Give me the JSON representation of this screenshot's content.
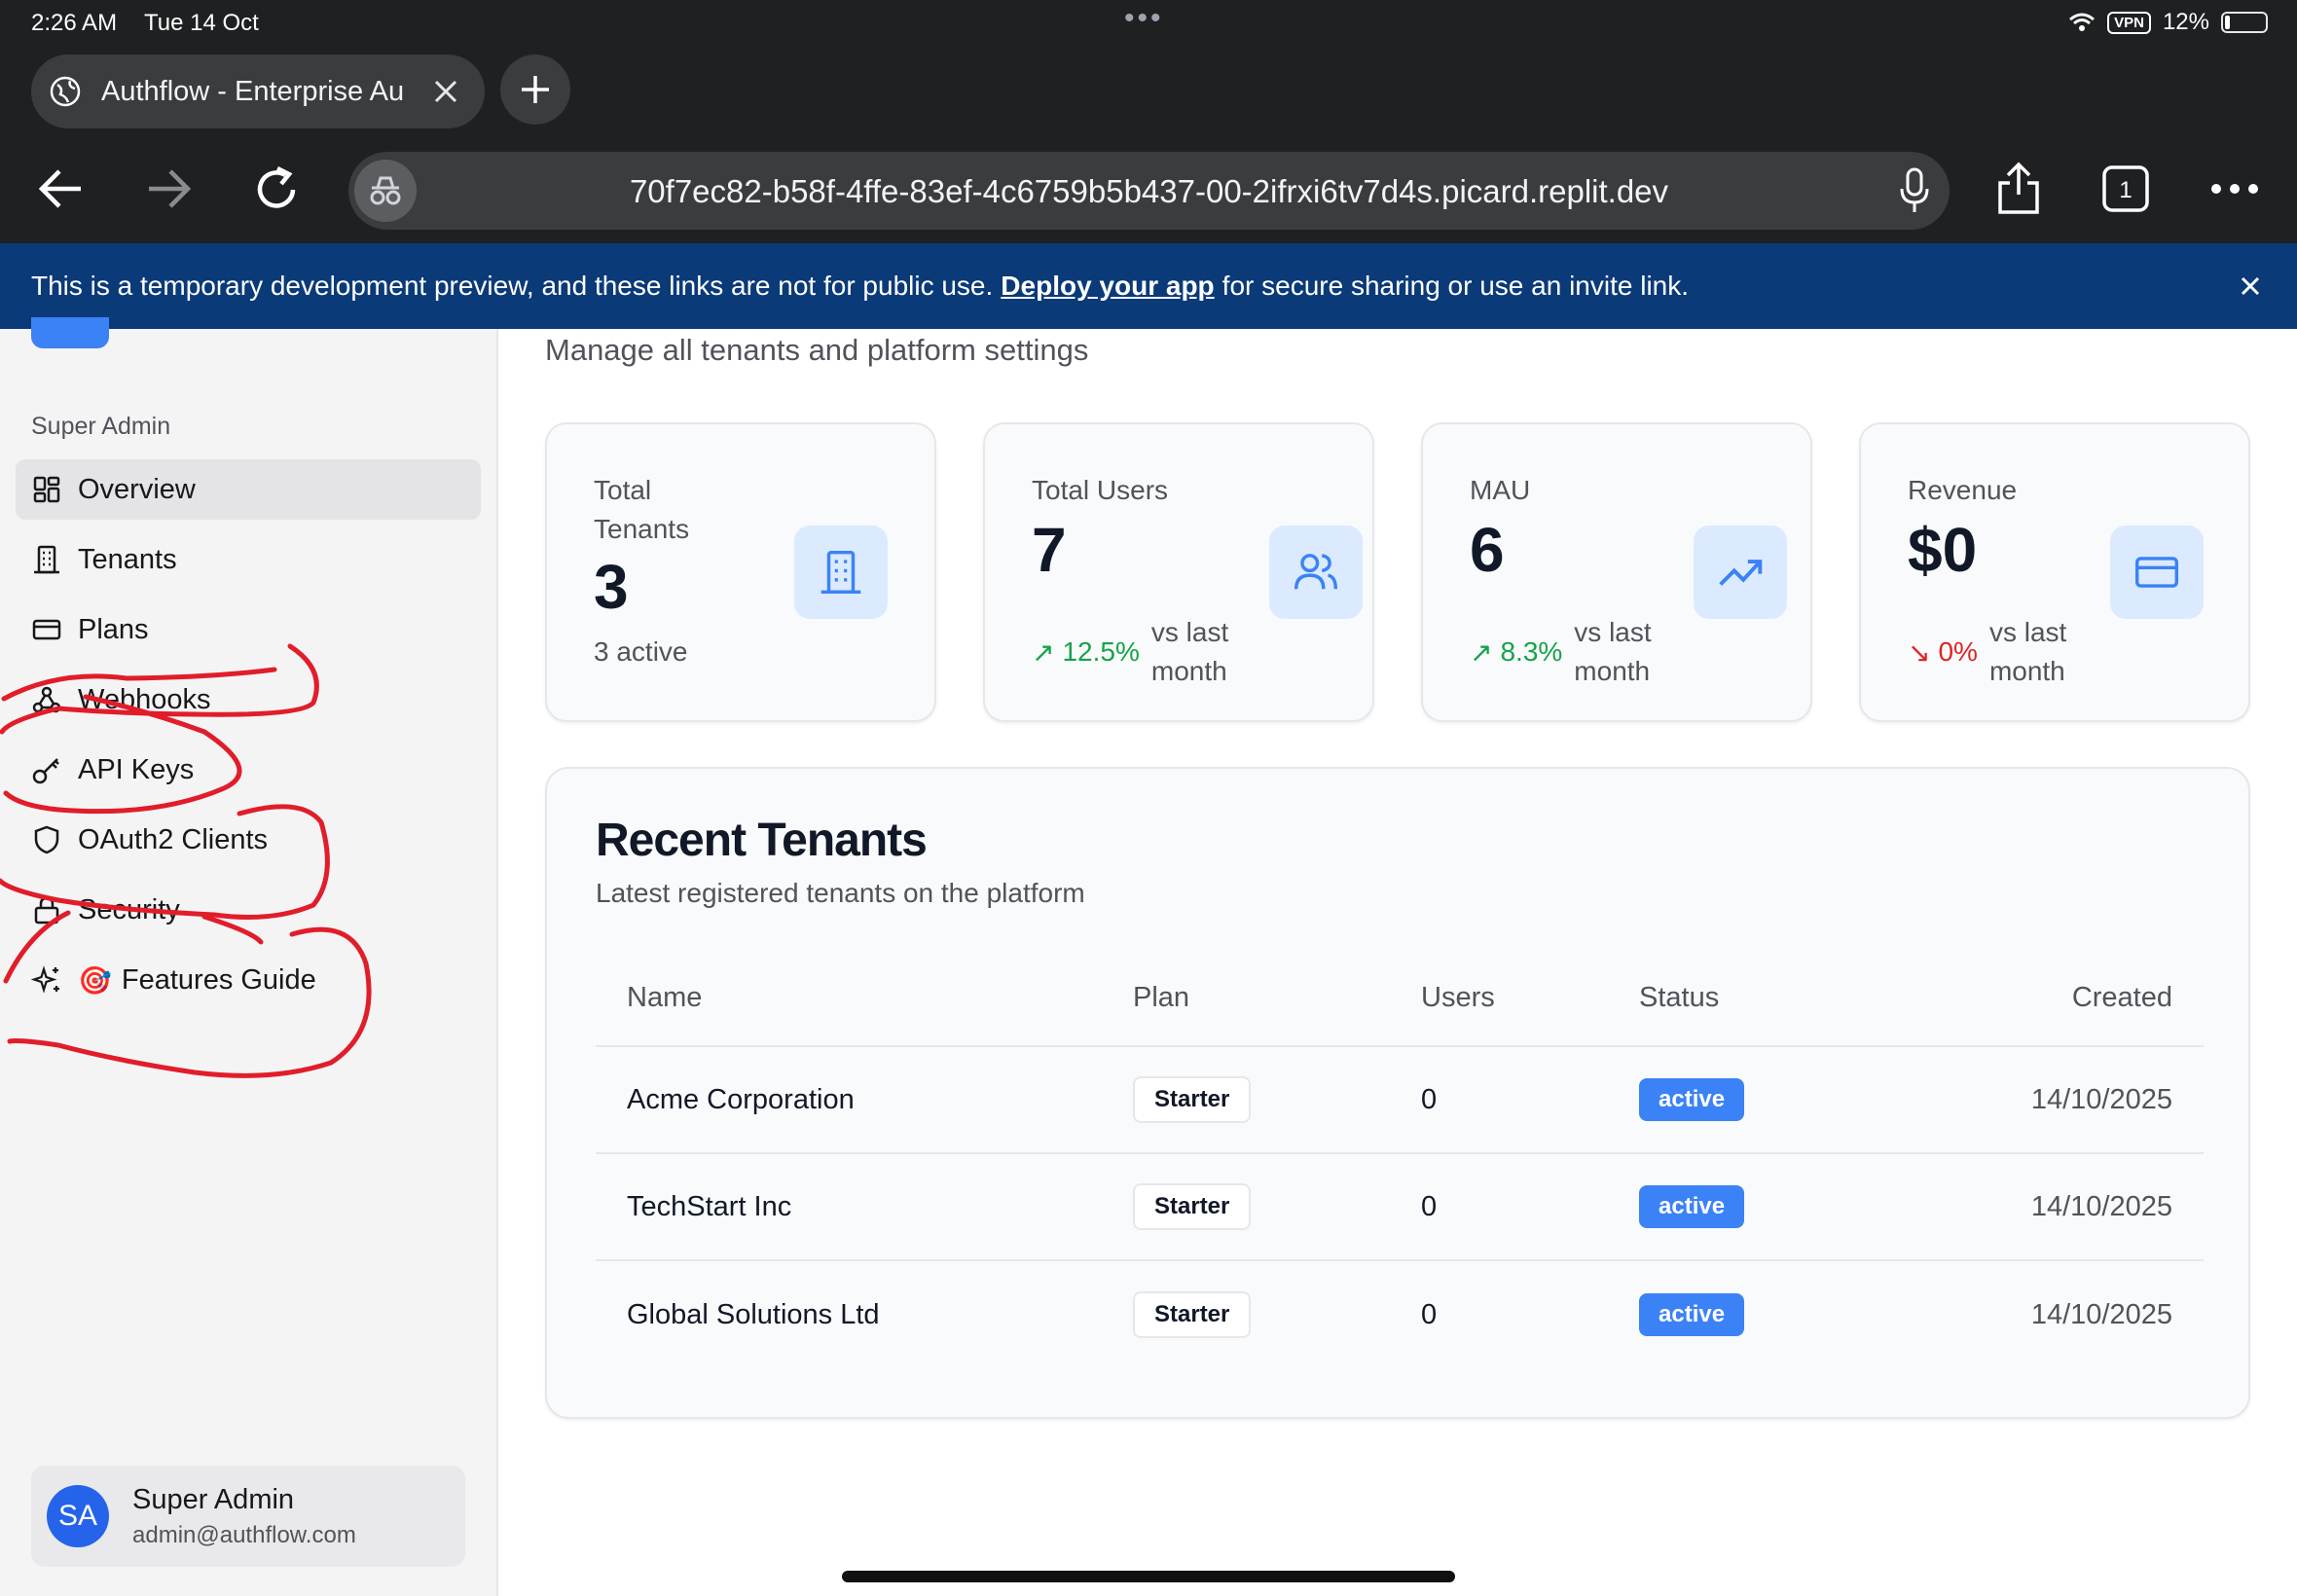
{
  "status_bar": {
    "time": "2:26 AM",
    "date": "Tue 14 Oct",
    "vpn": "VPN",
    "battery": "12%",
    "battery_level": 0.12
  },
  "browser": {
    "tab_title": "Authflow - Enterprise Au",
    "url": "70f7ec82-b58f-4ffe-83ef-4c6759b5b437-00-2ifrxi6tv7d4s.picard.replit.dev",
    "tab_count": "1"
  },
  "dev_banner": {
    "text_before": "This is a temporary development preview, and these links are not for public use.",
    "link": "Deploy your app",
    "text_after": "for secure sharing or use an invite link."
  },
  "sidebar": {
    "section": "Super Admin",
    "items": [
      {
        "label": "Overview",
        "icon": "layout-grid-icon",
        "active": true
      },
      {
        "label": "Tenants",
        "icon": "building-icon"
      },
      {
        "label": "Plans",
        "icon": "credit-card-icon"
      },
      {
        "label": "Webhooks",
        "icon": "webhook-icon"
      },
      {
        "label": "API Keys",
        "icon": "key-icon"
      },
      {
        "label": "OAuth2 Clients",
        "icon": "shield-icon"
      },
      {
        "label": "Security",
        "icon": "lock-icon"
      },
      {
        "label": "Features Guide",
        "icon": "sparkles-icon",
        "emoji": "🎯"
      }
    ],
    "user": {
      "initials": "SA",
      "name": "Super Admin",
      "email": "admin@authflow.com"
    }
  },
  "main": {
    "subtitle": "Manage all tenants and platform settings",
    "stats": [
      {
        "label": "Total Tenants",
        "value": "3",
        "sub": "3 active",
        "icon": "building-icon"
      },
      {
        "label": "Total Users",
        "value": "7",
        "trend": "12.5%",
        "trend_dir": "up",
        "note": "vs last month",
        "icon": "users-icon"
      },
      {
        "label": "MAU",
        "value": "6",
        "trend": "8.3%",
        "trend_dir": "up",
        "note": "vs last month",
        "icon": "trending-up-icon"
      },
      {
        "label": "Revenue",
        "value": "$0",
        "trend": "0%",
        "trend_dir": "down",
        "note": "vs last month",
        "icon": "credit-card-icon"
      }
    ],
    "recent": {
      "title": "Recent Tenants",
      "description": "Latest registered tenants on the platform",
      "columns": [
        "Name",
        "Plan",
        "Users",
        "Status",
        "Created"
      ],
      "rows": [
        {
          "name": "Acme Corporation",
          "plan": "Starter",
          "users": "0",
          "status": "active",
          "created": "14/10/2025"
        },
        {
          "name": "TechStart Inc",
          "plan": "Starter",
          "users": "0",
          "status": "active",
          "created": "14/10/2025"
        },
        {
          "name": "Global Solutions Ltd",
          "plan": "Starter",
          "users": "0",
          "status": "active",
          "created": "14/10/2025"
        }
      ]
    }
  },
  "colors": {
    "accent": "#3b82f6",
    "banner": "#0b3a78",
    "trend_up": "#16a34a",
    "trend_down": "#dc2626",
    "annotation": "#e11d2a"
  }
}
